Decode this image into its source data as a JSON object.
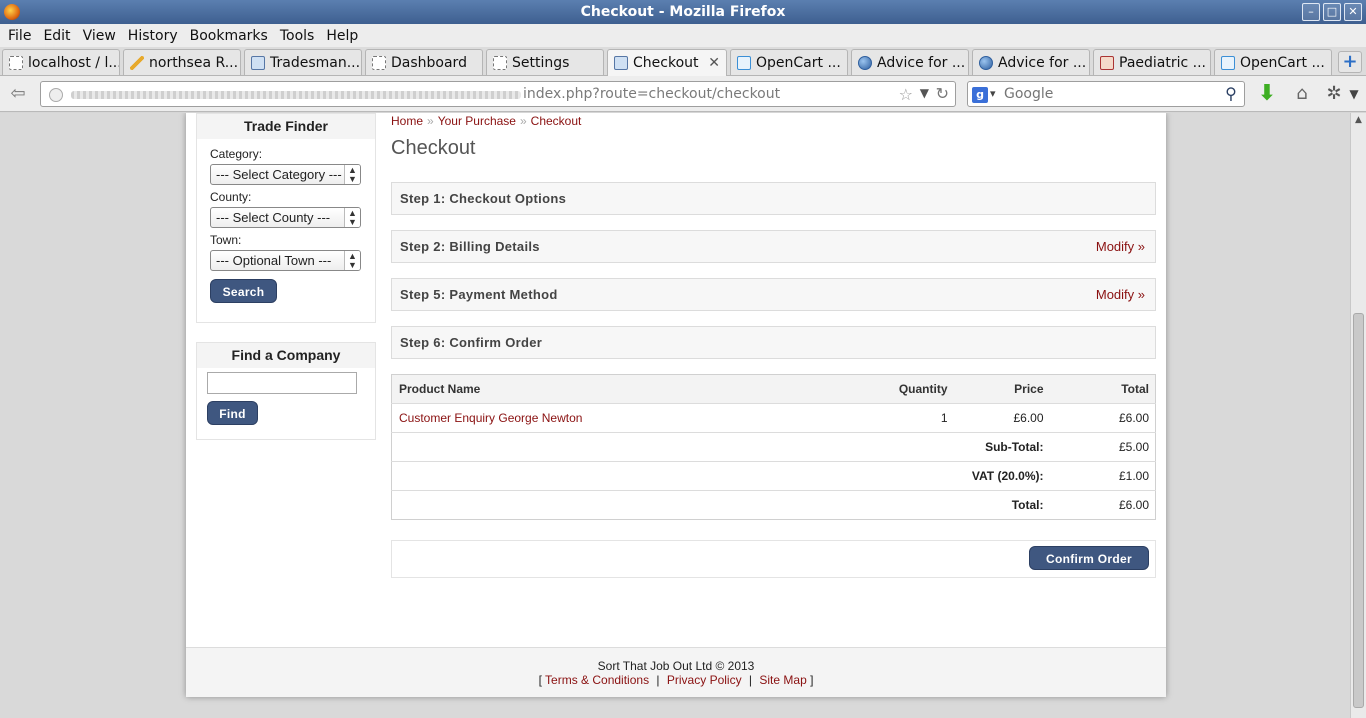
{
  "window": {
    "title": "Checkout - Mozilla Firefox"
  },
  "menubar": [
    "File",
    "Edit",
    "View",
    "History",
    "Bookmarks",
    "Tools",
    "Help"
  ],
  "tabs": [
    {
      "label": "localhost / l..."
    },
    {
      "label": "northsea R..."
    },
    {
      "label": "Tradesman..."
    },
    {
      "label": "Dashboard"
    },
    {
      "label": "Settings"
    },
    {
      "label": "Checkout",
      "active": true
    },
    {
      "label": "OpenCart ..."
    },
    {
      "label": "Advice for ..."
    },
    {
      "label": "Advice for ..."
    },
    {
      "label": "Paediatric ..."
    },
    {
      "label": "OpenCart ..."
    }
  ],
  "navbar": {
    "url": "index.php?route=checkout/checkout",
    "search_placeholder": "Google"
  },
  "sidebar": {
    "trade_finder": {
      "title": "Trade Finder",
      "category_label": "Category:",
      "category_value": "--- Select Category ---",
      "county_label": "County:",
      "county_value": "--- Select County ---",
      "town_label": "Town:",
      "town_value": "--- Optional Town ---",
      "search_button": "Search"
    },
    "find_company": {
      "title": "Find a Company",
      "input_value": "",
      "find_button": "Find"
    }
  },
  "breadcrumb": {
    "home": "Home",
    "sep": "»",
    "purchase": "Your Purchase",
    "checkout": "Checkout"
  },
  "main": {
    "title": "Checkout",
    "steps": [
      {
        "label": "Step 1: Checkout Options",
        "modify": ""
      },
      {
        "label": "Step 2: Billing Details",
        "modify": "Modify »"
      },
      {
        "label": "Step 5: Payment Method",
        "modify": "Modify »"
      },
      {
        "label": "Step 6: Confirm Order",
        "modify": ""
      }
    ],
    "cart": {
      "headers": {
        "product": "Product Name",
        "quantity": "Quantity",
        "price": "Price",
        "total": "Total"
      },
      "item": {
        "product": "Customer Enquiry George Newton",
        "quantity": "1",
        "price": "£6.00",
        "total": "£6.00"
      },
      "subtotal": {
        "label": "Sub-Total:",
        "value": "£5.00"
      },
      "vat": {
        "label": "VAT (20.0%):",
        "value": "£1.00"
      },
      "grand_total": {
        "label": "Total:",
        "value": "£6.00"
      }
    },
    "confirm_button": "Confirm Order"
  },
  "footer": {
    "copyright": "Sort That Job Out Ltd © 2013",
    "lbracket": "[",
    "rbracket": "]",
    "pipe": "|",
    "terms": "Terms & Conditions",
    "privacy": "Privacy Policy",
    "sitemap": "Site Map"
  },
  "colors": {
    "accent_link": "#8a1111",
    "button": "#3f5780",
    "titlebar": "#4a6ea2"
  }
}
